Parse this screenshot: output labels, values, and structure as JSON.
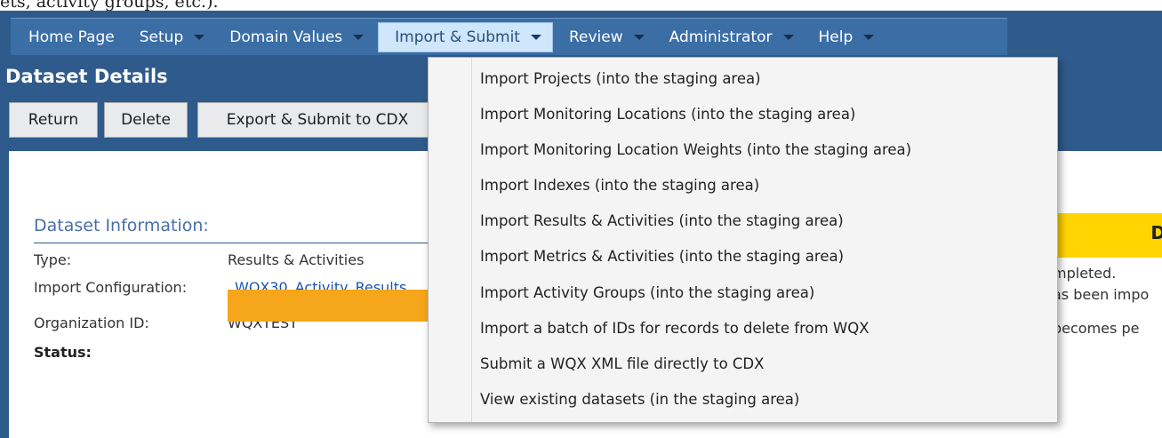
{
  "top_text": "ets, activity groups, etc.).",
  "menubar": {
    "items": [
      {
        "label": "Home Page",
        "has_caret": false
      },
      {
        "label": "Setup",
        "has_caret": true
      },
      {
        "label": "Domain Values",
        "has_caret": true
      },
      {
        "label": "Import & Submit",
        "has_caret": true,
        "active": true
      },
      {
        "label": "Review",
        "has_caret": true
      },
      {
        "label": "Administrator",
        "has_caret": true
      },
      {
        "label": "Help",
        "has_caret": true
      }
    ]
  },
  "page": {
    "title": "Dataset Details"
  },
  "toolbar": {
    "return_label": "Return",
    "delete_label": "Delete",
    "export_label": "Export & Submit to CDX"
  },
  "dataset_info": {
    "section_title": "Dataset Information:",
    "type_label": "Type:",
    "type_value": "Results & Activities",
    "import_config_label": "Import Configuration:",
    "import_config_value": "_WQX30_Activity_Results",
    "org_id_label": "Organization ID:",
    "org_id_value": "WQXTEST",
    "status_label": "Status:"
  },
  "right_panel": {
    "header_partial": "D",
    "line1": "mpleted.",
    "line2": "as been impo",
    "line3": "becomes pe"
  },
  "dropdown": {
    "items": [
      "Import Projects (into the staging area)",
      "Import Monitoring Locations (into the staging area)",
      "Import Monitoring Location Weights (into the staging area)",
      "Import Indexes (into the staging area)",
      "Import Results & Activities (into the staging area)",
      "Import Metrics & Activities (into the staging area)",
      "Import Activity Groups (into the staging area)",
      "Import a batch of IDs for records to delete from WQX",
      "Submit a WQX XML file directly to CDX",
      "View existing datasets (in the staging area)"
    ]
  },
  "colors": {
    "app_background": "#2e5b8c",
    "menubar": "#3a6ea5",
    "active_menu": "#cfe6fb",
    "status_bar": "#f5a61a",
    "right_header": "#ffd400",
    "link": "#1a56b3"
  }
}
